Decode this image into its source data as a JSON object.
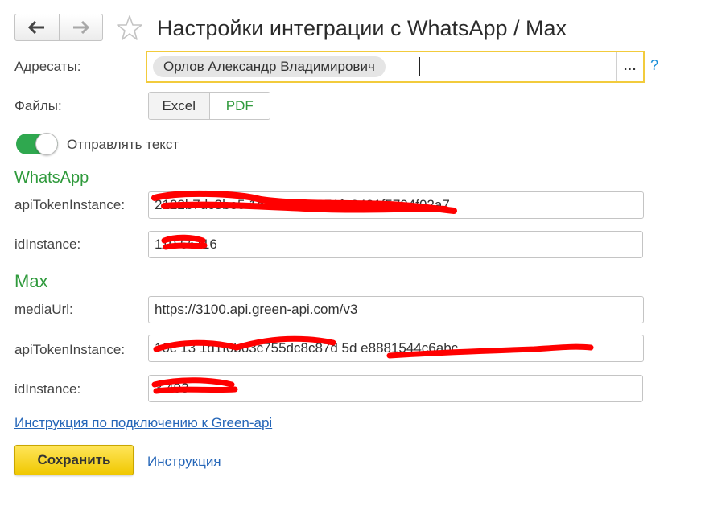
{
  "header": {
    "back_icon": "arrow-left-icon",
    "forward_icon": "arrow-right-icon",
    "favorite_icon": "star-icon",
    "title": "Настройки интеграции с WhatsApp / Max"
  },
  "recipients": {
    "label": "Адресаты:",
    "chip": "Орлов Александр Владимирович",
    "select_button": "...",
    "help": "?"
  },
  "files": {
    "label": "Файлы:",
    "options": [
      "Excel",
      "PDF"
    ],
    "selected": "PDF"
  },
  "send_text": {
    "label": "Отправлять текст",
    "enabled": true
  },
  "whatsapp": {
    "section_title": "WhatsApp",
    "api_token_label": "apiTokenInstance:",
    "api_token_value": "2122b7dc3be5 1d c                ee981871fe2481f5794f02a7",
    "id_label": "idInstance:",
    "id_value": "110     56116"
  },
  "max": {
    "section_title": "Max",
    "media_url_label": "mediaUrl:",
    "media_url_value": "https://3100.api.green-api.com/v3",
    "api_token_label": "apiTokenInstance:",
    "api_token_value": "10c          13 1d1f0b63c755dc8c87d  5d       e8881544c6abc",
    "id_label": "idInstance:",
    "id_value": "3          493"
  },
  "links": {
    "instructions_green_api": "Инструкция по подключению к Green-api",
    "instructions": "Инструкция"
  },
  "actions": {
    "save": "Сохранить"
  },
  "colors": {
    "accent_green": "#2f9a3c",
    "button_yellow": "#f5d21a",
    "link_blue": "#2566b8",
    "focus_border": "#f2cb3c",
    "redaction_red": "#ff0000"
  }
}
